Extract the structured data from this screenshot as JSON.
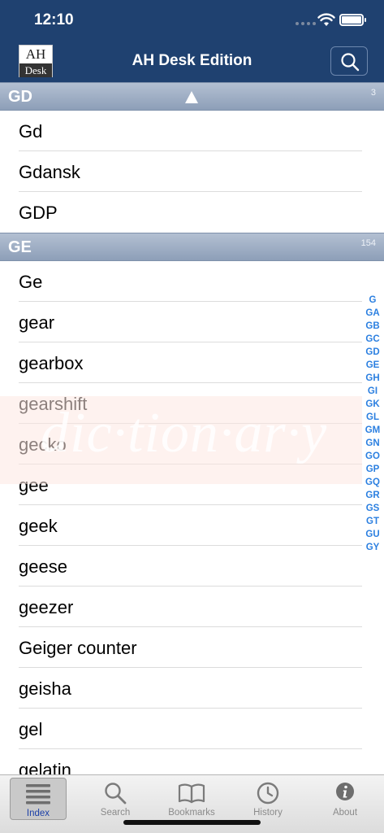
{
  "status_bar": {
    "time": "12:10"
  },
  "header": {
    "logo_top": "AH",
    "logo_bottom": "Desk",
    "title": "AH Desk Edition"
  },
  "sections": [
    {
      "letter": "GD",
      "count": "3",
      "items": [
        "Gd",
        "Gdansk",
        "GDP"
      ]
    },
    {
      "letter": "GE",
      "count": "154",
      "items": [
        "Ge",
        "gear",
        "gearbox",
        "gearshift",
        "gecko",
        "gee",
        "geek",
        "geese",
        "geezer",
        "Geiger counter",
        "geisha",
        "gel",
        "gelatin"
      ]
    }
  ],
  "watermark": "dic·tion·ar·y",
  "index_letters": [
    "G",
    "GA",
    "GB",
    "GC",
    "GD",
    "GE",
    "GH",
    "GI",
    "GK",
    "GL",
    "GM",
    "GN",
    "GO",
    "GP",
    "GQ",
    "GR",
    "GS",
    "GT",
    "GU",
    "GY"
  ],
  "tabs": [
    {
      "label": "Index",
      "icon": "list-icon",
      "active": true
    },
    {
      "label": "Search",
      "icon": "search-icon",
      "active": false
    },
    {
      "label": "Bookmarks",
      "icon": "book-icon",
      "active": false
    },
    {
      "label": "History",
      "icon": "clock-icon",
      "active": false
    },
    {
      "label": "About",
      "icon": "info-icon",
      "active": false
    }
  ],
  "colors": {
    "nav": "#1f4170",
    "index_letters": "#2b7fe0",
    "active_tab_label": "#1b3fa8"
  }
}
